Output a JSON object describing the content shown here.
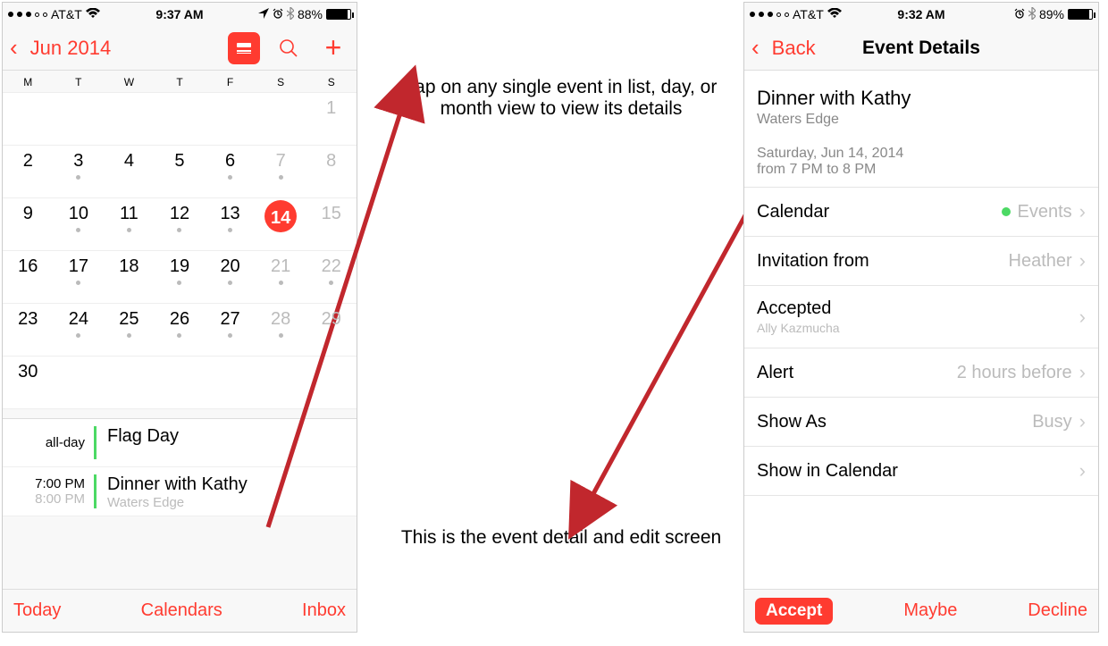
{
  "left": {
    "status": {
      "carrier": "AT&T",
      "time": "9:37 AM",
      "battery_pct": "88%"
    },
    "nav": {
      "back_label": "Jun 2014",
      "icons": {
        "view": "≣",
        "search": "search",
        "add": "+"
      }
    },
    "weekdays": [
      "M",
      "T",
      "W",
      "T",
      "F",
      "S",
      "S"
    ],
    "weeks": [
      [
        {
          "n": "",
          "dim": false
        },
        {
          "n": "",
          "dim": false
        },
        {
          "n": "",
          "dim": false
        },
        {
          "n": "",
          "dim": false
        },
        {
          "n": "",
          "dim": false
        },
        {
          "n": "",
          "dim": true
        },
        {
          "n": "1",
          "dim": true
        }
      ],
      [
        {
          "n": "2"
        },
        {
          "n": "3",
          "dot": true
        },
        {
          "n": "4"
        },
        {
          "n": "5"
        },
        {
          "n": "6",
          "dot": true
        },
        {
          "n": "7",
          "dim": true,
          "dot": true
        },
        {
          "n": "8",
          "dim": true
        }
      ],
      [
        {
          "n": "9"
        },
        {
          "n": "10",
          "dot": true
        },
        {
          "n": "11",
          "dot": true
        },
        {
          "n": "12",
          "dot": true
        },
        {
          "n": "13",
          "dot": true
        },
        {
          "n": "14",
          "dim": false,
          "dot": true,
          "selected": true
        },
        {
          "n": "15",
          "dim": true
        }
      ],
      [
        {
          "n": "16"
        },
        {
          "n": "17",
          "dot": true
        },
        {
          "n": "18"
        },
        {
          "n": "19",
          "dot": true
        },
        {
          "n": "20",
          "dot": true
        },
        {
          "n": "21",
          "dim": true,
          "dot": true
        },
        {
          "n": "22",
          "dim": true,
          "dot": true
        }
      ],
      [
        {
          "n": "23"
        },
        {
          "n": "24",
          "dot": true
        },
        {
          "n": "25",
          "dot": true
        },
        {
          "n": "26",
          "dot": true
        },
        {
          "n": "27",
          "dot": true
        },
        {
          "n": "28",
          "dim": true,
          "dot": true
        },
        {
          "n": "29",
          "dim": true
        }
      ],
      [
        {
          "n": "30"
        },
        {
          "n": ""
        },
        {
          "n": ""
        },
        {
          "n": ""
        },
        {
          "n": ""
        },
        {
          "n": ""
        },
        {
          "n": ""
        }
      ]
    ],
    "events": [
      {
        "time1": "all-day",
        "time2": "",
        "title": "Flag Day",
        "loc": ""
      },
      {
        "time1": "7:00 PM",
        "time2": "8:00 PM",
        "title": "Dinner with Kathy",
        "loc": "Waters Edge"
      }
    ],
    "toolbar": {
      "today": "Today",
      "calendars": "Calendars",
      "inbox": "Inbox"
    }
  },
  "right": {
    "status": {
      "carrier": "AT&T",
      "time": "9:32 AM",
      "battery_pct": "89%"
    },
    "nav": {
      "back_label": "Back",
      "title": "Event Details"
    },
    "event": {
      "title": "Dinner with Kathy",
      "location": "Waters Edge",
      "date": "Saturday, Jun 14, 2014",
      "time": "from 7 PM to 8 PM"
    },
    "rows": {
      "calendar_label": "Calendar",
      "calendar_value": "Events",
      "invitation_label": "Invitation from",
      "invitation_value": "Heather",
      "accepted_label": "Accepted",
      "accepted_sub": "Ally Kazmucha",
      "alert_label": "Alert",
      "alert_value": "2 hours before",
      "showas_label": "Show As",
      "showas_value": "Busy",
      "showin_label": "Show in Calendar"
    },
    "toolbar": {
      "accept": "Accept",
      "maybe": "Maybe",
      "decline": "Decline"
    }
  },
  "annotations": {
    "top": "Tap on any single event in list, day, or month view to view its details",
    "bottom": "This is the event detail and edit screen"
  }
}
